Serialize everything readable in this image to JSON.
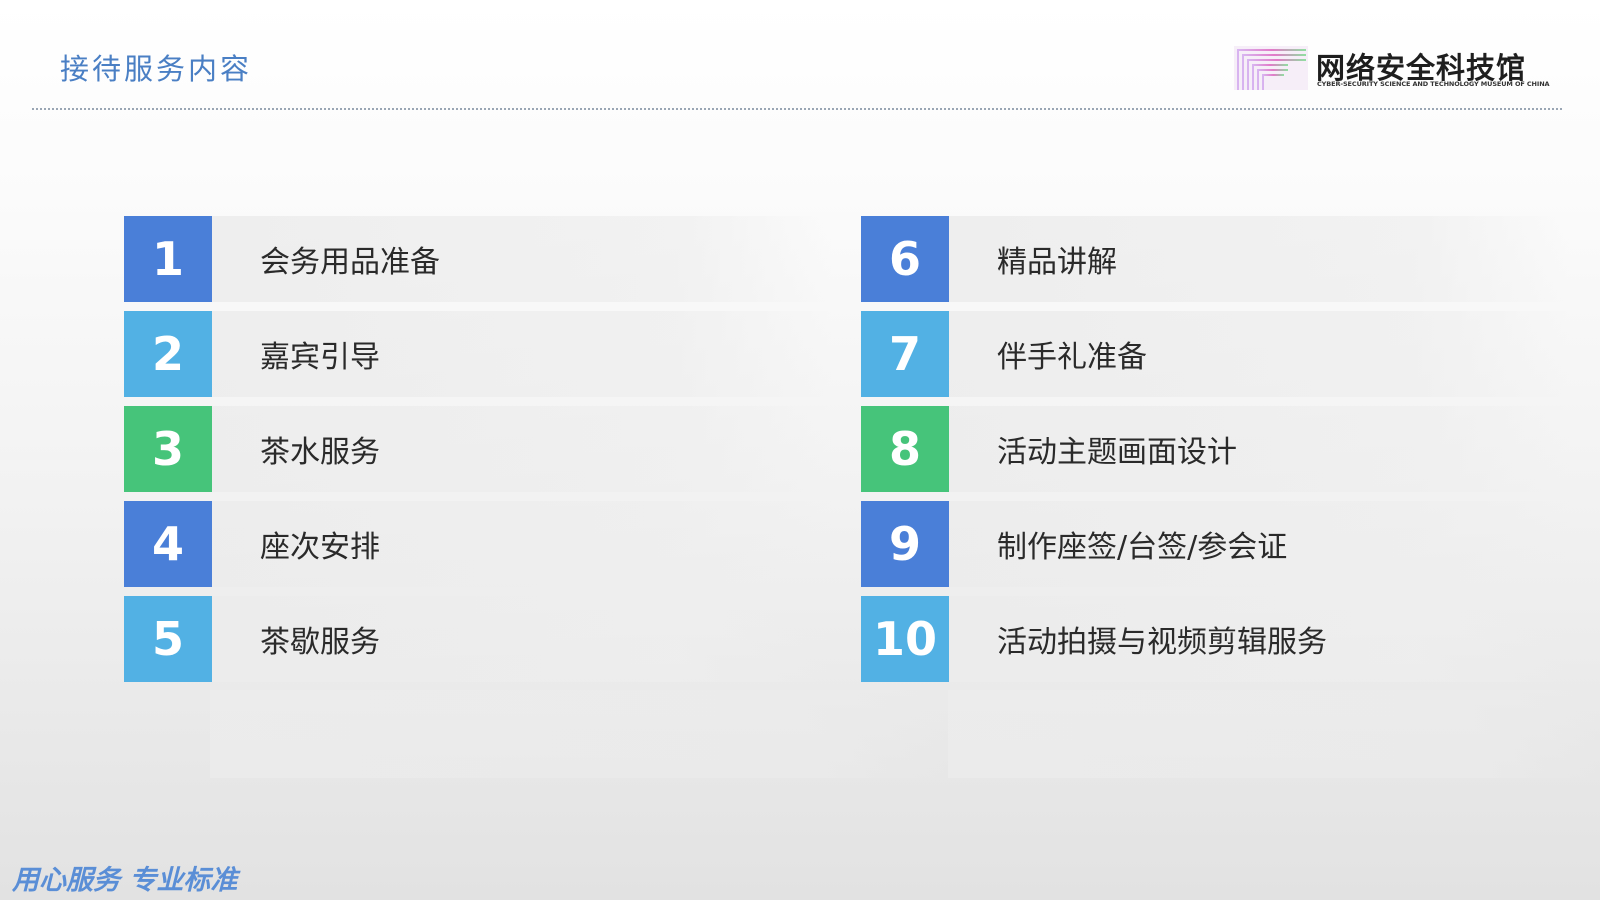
{
  "header": {
    "title": "接待服务内容",
    "logo": {
      "name": "网络安全科技馆",
      "subtitle": "CYBER-SECURITY SCIENCE AND TECHNOLOGY MUSEUM OF CHINA",
      "icon": "museum-logo-mark"
    }
  },
  "colors": {
    "title": "#4a7fc4",
    "box_blue": "#4a7fd8",
    "box_light_blue": "#52b1e4",
    "box_green": "#46c47a",
    "slogan": "#5a8ed6"
  },
  "items": [
    {
      "number": "1",
      "label": "会务用品准备",
      "color": "#4a7fd8"
    },
    {
      "number": "2",
      "label": "嘉宾引导",
      "color": "#52b1e4"
    },
    {
      "number": "3",
      "label": "茶水服务",
      "color": "#46c47a"
    },
    {
      "number": "4",
      "label": "座次安排",
      "color": "#4a7fd8"
    },
    {
      "number": "5",
      "label": "茶歇服务",
      "color": "#52b1e4"
    },
    {
      "number": "6",
      "label": "精品讲解",
      "color": "#4a7fd8"
    },
    {
      "number": "7",
      "label": "伴手礼准备",
      "color": "#52b1e4"
    },
    {
      "number": "8",
      "label": "活动主题画面设计",
      "color": "#46c47a"
    },
    {
      "number": "9",
      "label": "制作座签/台签/参会证",
      "color": "#4a7fd8"
    },
    {
      "number": "10",
      "label": "活动拍摄与视频剪辑服务",
      "color": "#52b1e4"
    }
  ],
  "footer": {
    "slogan": "用心服务  专业标准"
  }
}
